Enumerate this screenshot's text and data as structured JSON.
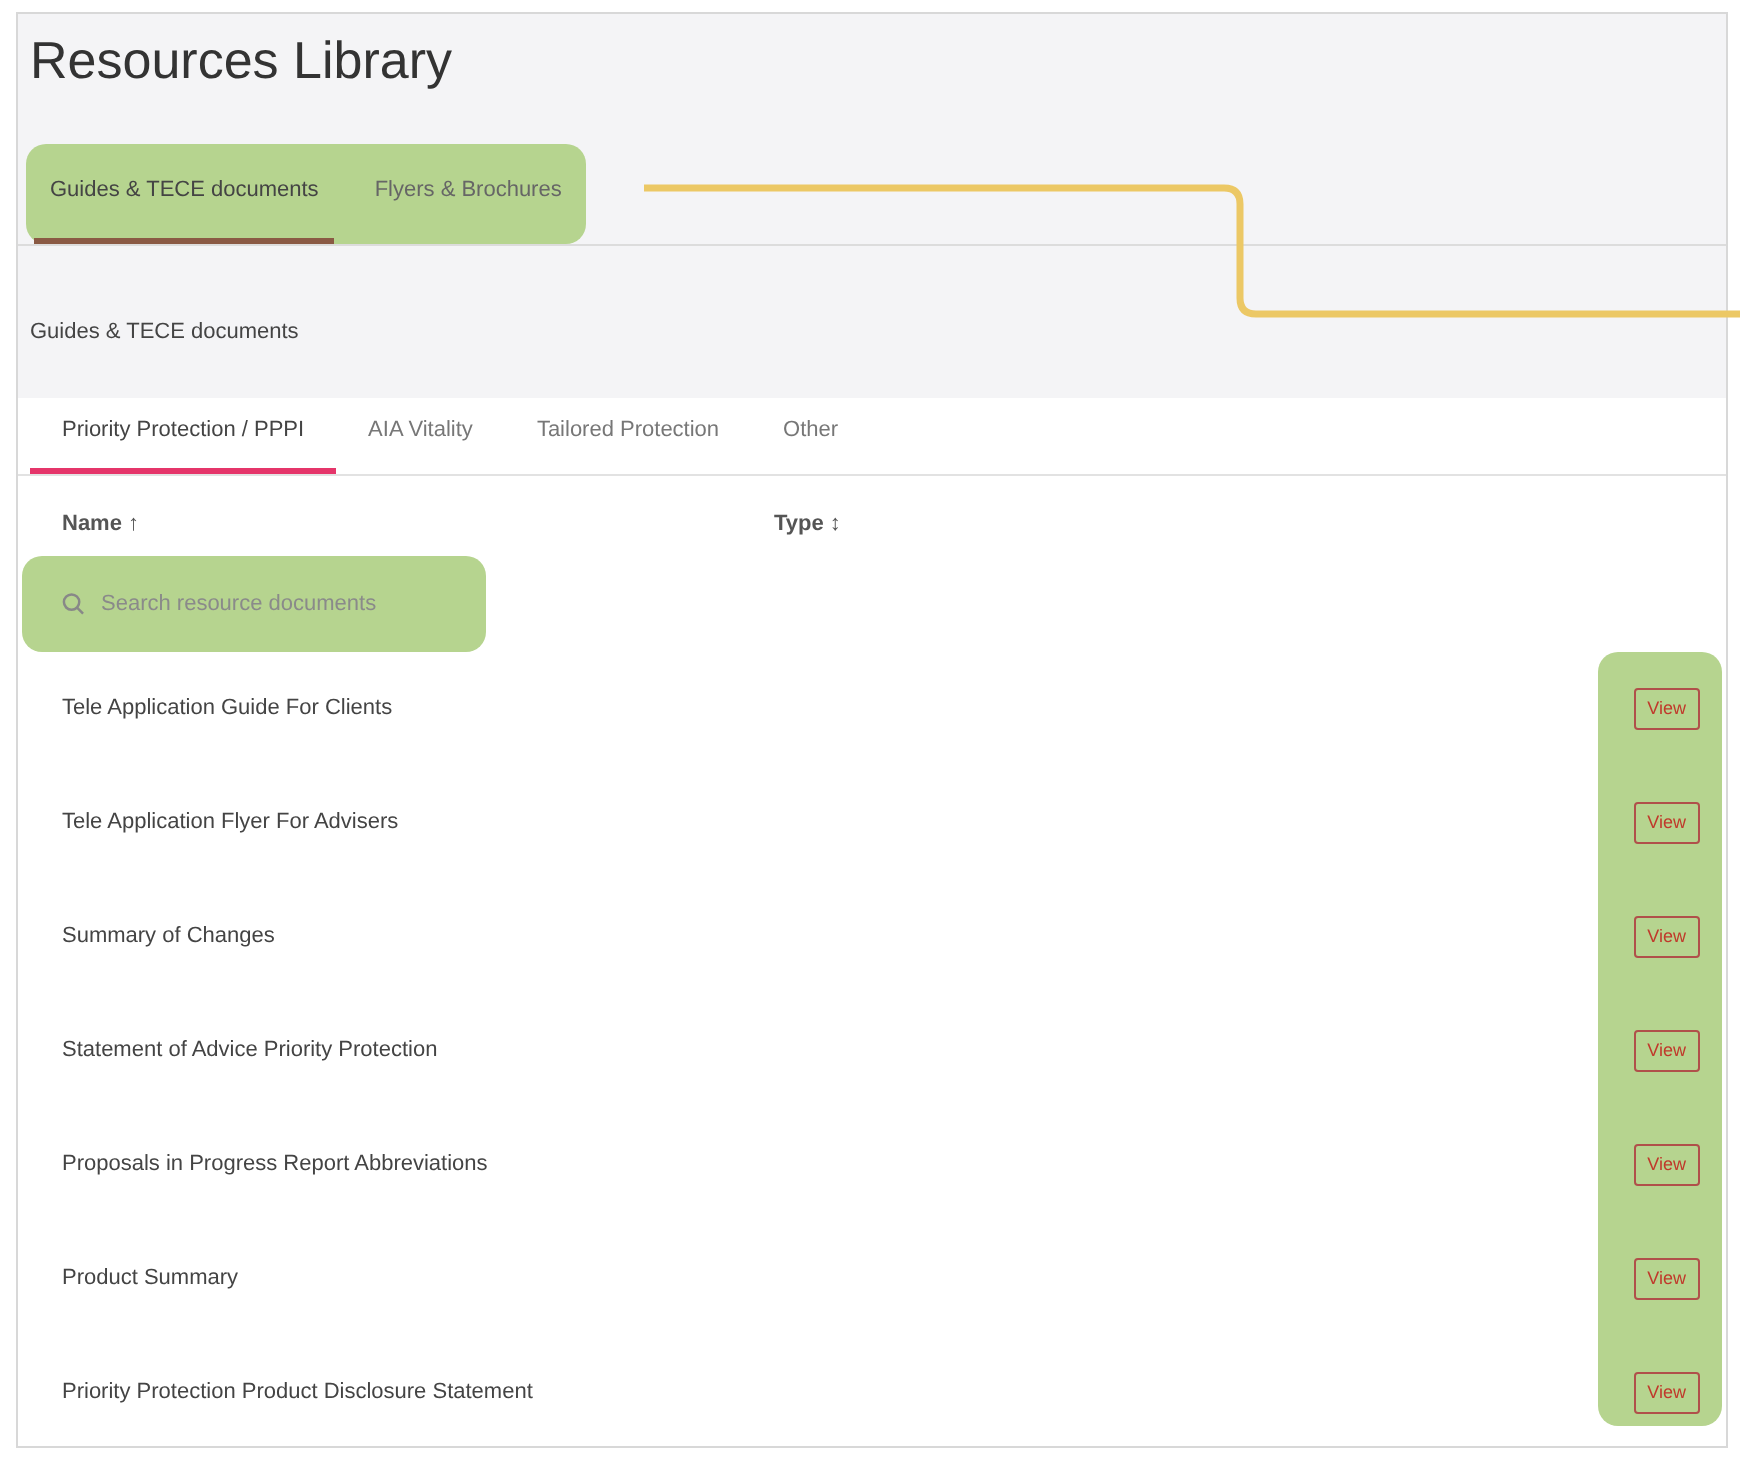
{
  "title": "Resources Library",
  "tabs": [
    {
      "label": "Guides & TECE documents",
      "selected": true
    },
    {
      "label": "Flyers & Brochures",
      "selected": false
    }
  ],
  "section_title": "Guides & TECE documents",
  "sub_tabs": [
    {
      "label": "Priority Protection / PPPI",
      "selected": true
    },
    {
      "label": "AIA Vitality",
      "selected": false
    },
    {
      "label": "Tailored Protection",
      "selected": false
    },
    {
      "label": "Other",
      "selected": false
    }
  ],
  "table": {
    "columns": [
      "Name ↑",
      "Type ↕"
    ],
    "search": {
      "placeholder": "Search resource documents"
    },
    "rows": [
      {
        "name": "Tele Application Guide For Clients",
        "action": "View"
      },
      {
        "name": "Tele Application Flyer For Advisers",
        "action": "View"
      },
      {
        "name": "Summary of Changes",
        "action": "View"
      },
      {
        "name": "Statement of Advice Priority Protection",
        "action": "View"
      },
      {
        "name": "Proposals in Progress Report Abbreviations",
        "action": "View"
      },
      {
        "name": "Product Summary",
        "action": "View"
      },
      {
        "name": "Priority Protection Product Disclosure Statement",
        "action": "View"
      }
    ]
  }
}
